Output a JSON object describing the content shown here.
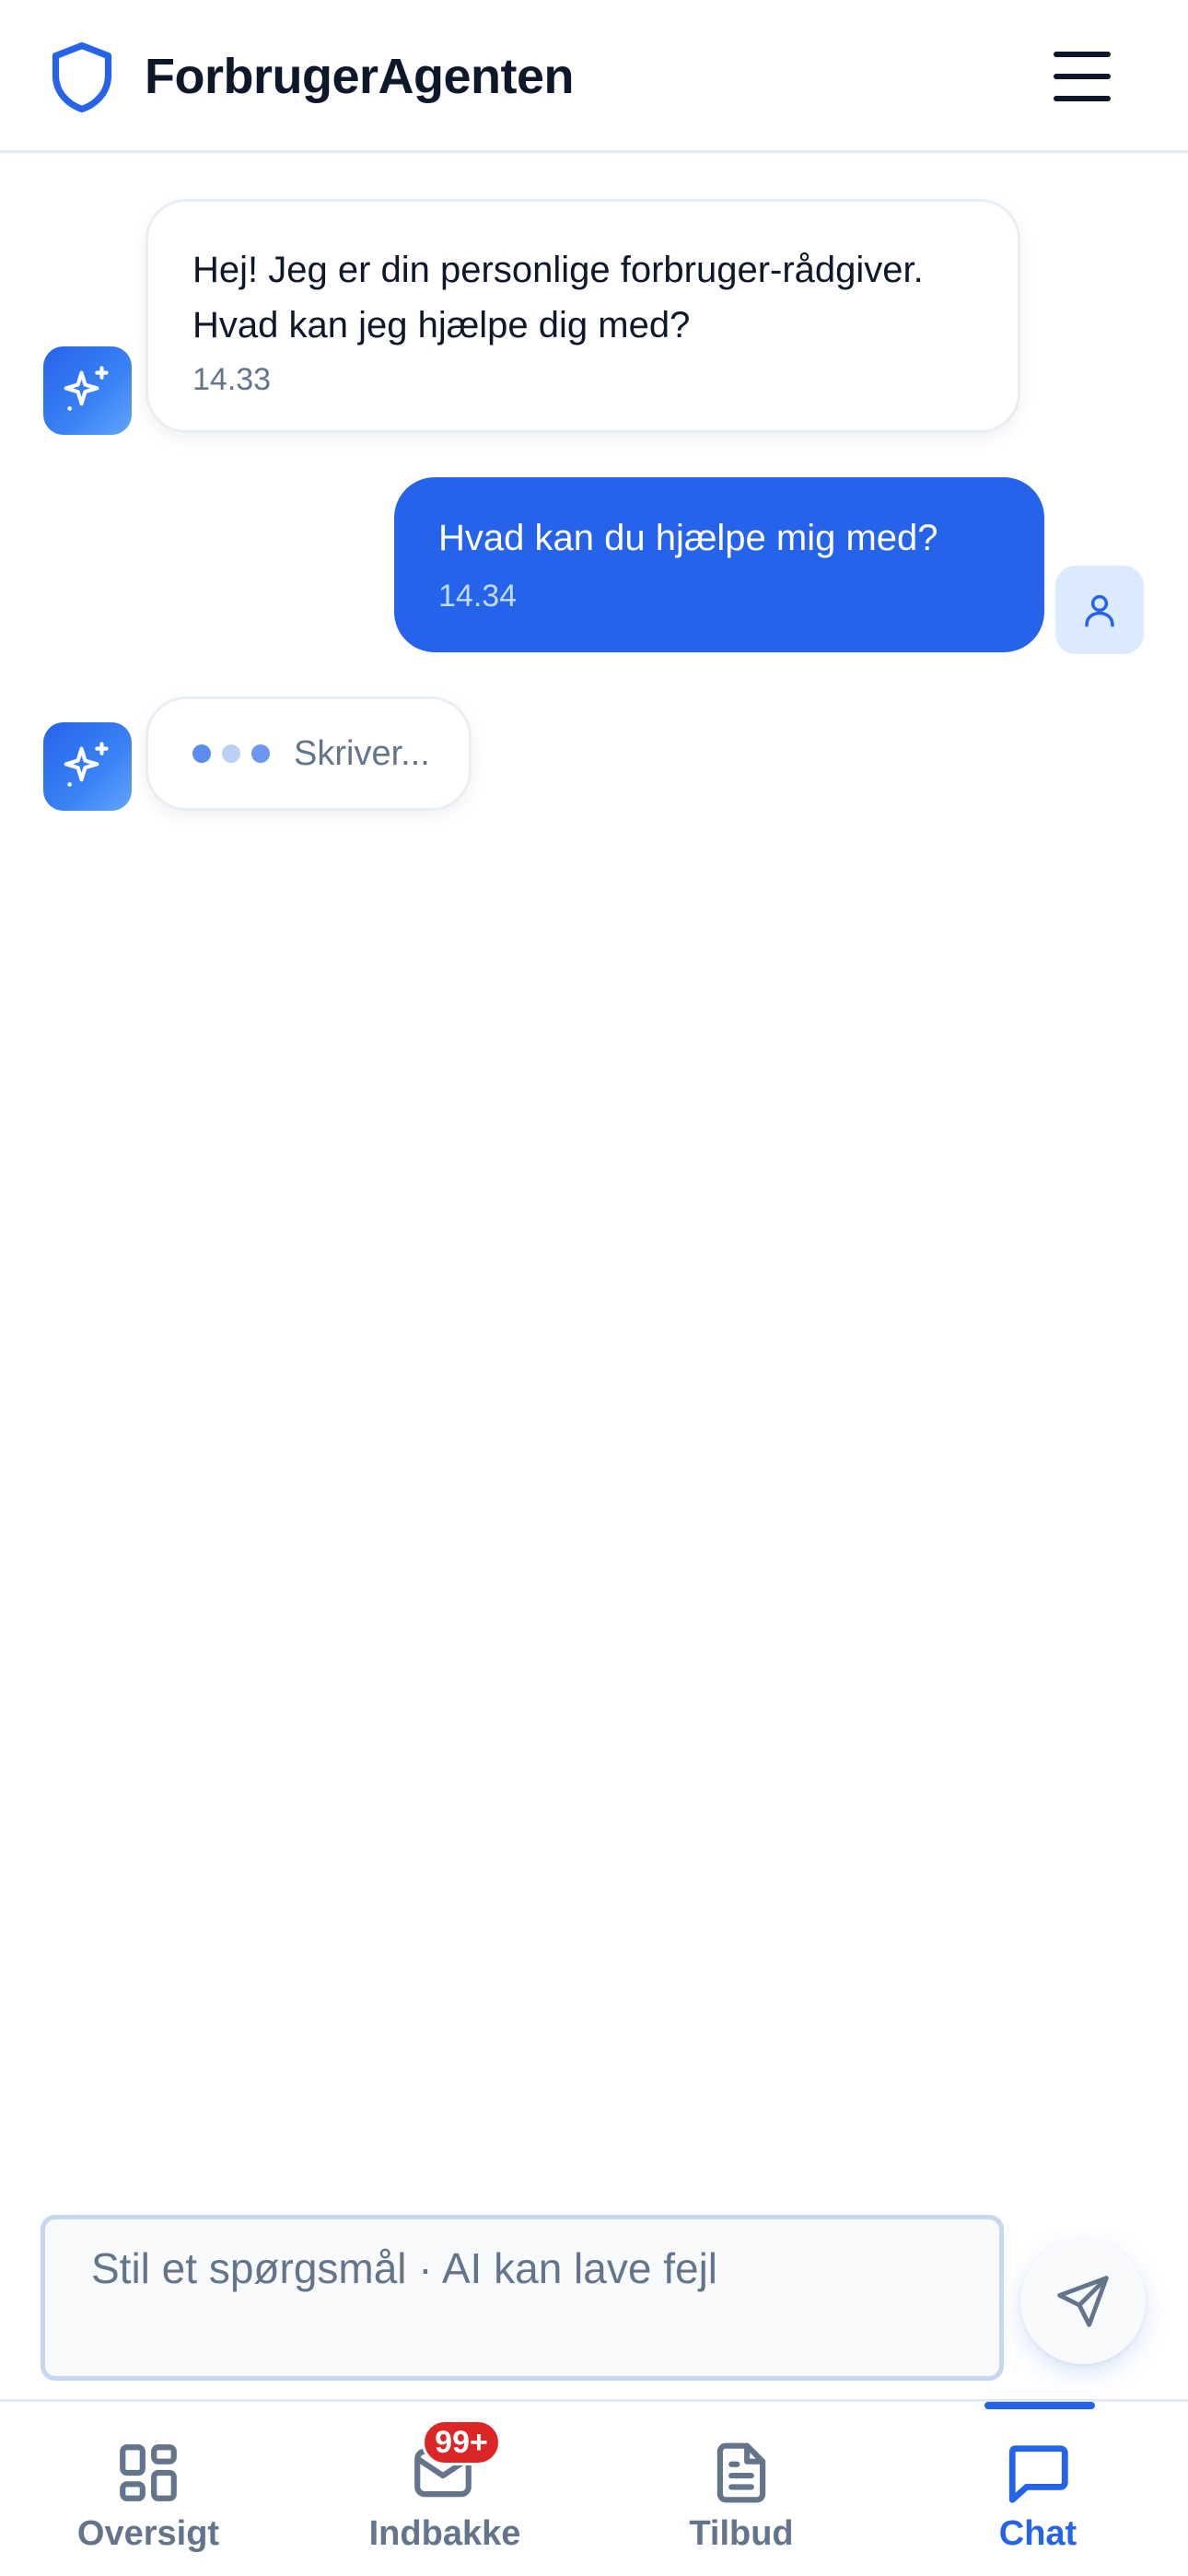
{
  "header": {
    "app_name": "ForbrugerAgenten",
    "logo_icon": "shield-icon",
    "menu_icon": "hamburger-menu-icon"
  },
  "messages": [
    {
      "role": "assistant",
      "text": "Hej! Jeg er din personlige forbruger-rådgiver. Hvad kan jeg hjælpe dig med?",
      "time": "14.33",
      "avatar_icon": "sparkles-icon"
    },
    {
      "role": "user",
      "text": "Hvad kan du hjælpe mig med?",
      "time": "14.34",
      "avatar_icon": "user-icon"
    }
  ],
  "typing": {
    "label": "Skriver...",
    "avatar_icon": "sparkles-icon"
  },
  "composer": {
    "placeholder": "Stil et spørgsmål · AI kan lave fejl",
    "value": "",
    "send_icon": "send-icon"
  },
  "bottom_nav": {
    "items": [
      {
        "label": "Oversigt",
        "icon": "grid-icon",
        "active": false
      },
      {
        "label": "Indbakke",
        "icon": "inbox-icon",
        "active": false,
        "badge": "99+"
      },
      {
        "label": "Tilbud",
        "icon": "document-icon",
        "active": false
      },
      {
        "label": "Chat",
        "icon": "chat-bubble-icon",
        "active": true
      }
    ]
  },
  "colors": {
    "accent": "#2563eb",
    "text": "#0f172a",
    "muted": "#64748b",
    "badge": "#dc2626"
  }
}
